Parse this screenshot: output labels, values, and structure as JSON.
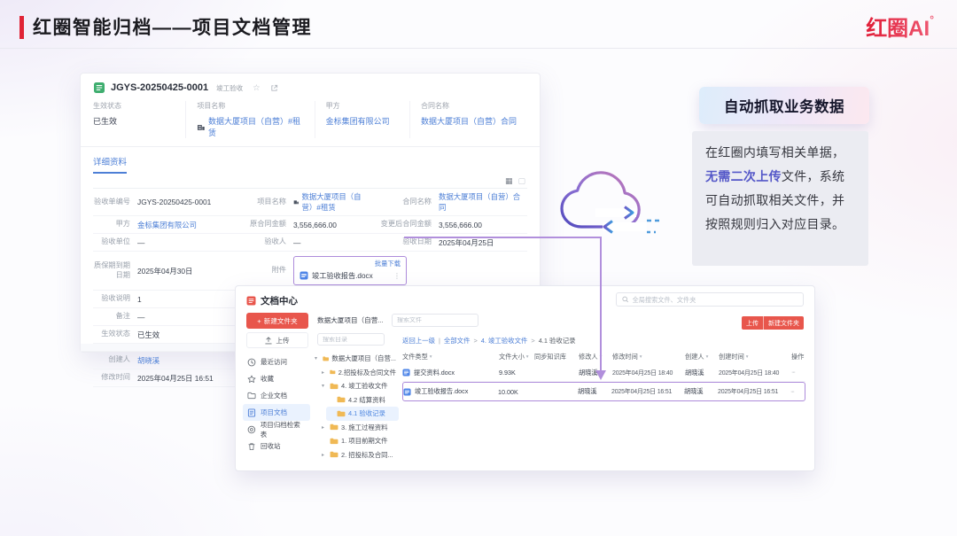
{
  "header": {
    "title": "红圈智能归档——项目文档管理",
    "logo_text": "红圈AI",
    "logo_sup": "°"
  },
  "icons": {
    "star": "☆",
    "share": "⧉",
    "grid": "▦",
    "panel": "▢",
    "more_v": "⋮",
    "more_h": "···",
    "caret": "▾",
    "open": "▾",
    "closed": "▸",
    "plus": "+",
    "sep_bar": "|",
    "sep_gt": ">"
  },
  "form": {
    "number": "JGYS-20250425-0001",
    "type_tag": "竣工验收",
    "summary": {
      "status_label": "生效状态",
      "status": "已生效",
      "project_label": "项目名称",
      "project": "数据大厦项目（自营）#租赁",
      "party_a_label": "甲方",
      "party_a": "金标集团有限公司",
      "contract_label": "合同名称",
      "contract": "数据大厦项目（自营）合同"
    },
    "tab": "详细资料",
    "detail": {
      "acceptance_no_label": "验收单编号",
      "acceptance_no": "JGYS-20250425-0001",
      "project_label": "项目名称",
      "project": "数据大厦项目（自营）#租赁",
      "contract_label": "合同名称",
      "contract": "数据大厦项目（自营）合同",
      "party_a_label": "甲方",
      "party_a": "金标集团有限公司",
      "orig_amount_label": "原合同金额",
      "orig_amount": "3,556,666.00",
      "changed_amount_label": "变更后合同金额",
      "changed_amount": "3,556,666.00",
      "accept_unit_label": "验收单位",
      "accept_unit": "—",
      "acceptor_label": "验收人",
      "acceptor": "—",
      "accept_date_label": "验收日期",
      "accept_date": "2025年04月25日",
      "warranty_label": "质保期到期日期",
      "warranty": "2025年04月30日",
      "attachment_label": "附件",
      "batch_download": "批量下载",
      "attachment_file": "竣工验收报告.docx",
      "accept_note_label": "验收说明",
      "accept_note": "1",
      "remark_label": "备注",
      "remark": "—",
      "status_label": "生效状态",
      "status": "已生效",
      "creator_label": "创建人",
      "creator": "胡晓溪",
      "modified_label": "修改时间",
      "modified_time": "2025年04月25日 16:51"
    }
  },
  "doc_center": {
    "title": "文档中心",
    "global_search_placeholder": "全局搜索文件、文件夹",
    "new_folder_button": "新建文件夹",
    "upload_button": "上传",
    "top_upload_button": "上传",
    "top_new_folder_button": "新建文件夹",
    "project_tab": "数据大厦项目（自营...",
    "search_file_placeholder": "搜索文件",
    "search_dir_placeholder": "搜索目录",
    "breadcrumb": {
      "back": "返回上一级",
      "items": [
        "全部文件",
        "4. 竣工验收文件",
        "4.1 验收记录"
      ]
    },
    "nav": [
      {
        "label": "最近访问"
      },
      {
        "label": "收藏"
      },
      {
        "label": "企业文档"
      },
      {
        "label": "项目文档"
      },
      {
        "label": "项目归档检索表"
      },
      {
        "label": "回收站"
      }
    ],
    "tree": [
      {
        "label": "数据大厦项目（自营..."
      },
      {
        "label": "2.招投标及合同文件"
      },
      {
        "label": "4. 竣工验收文件"
      },
      {
        "label": "4.2 结算资料"
      },
      {
        "label": "4.1 验收记录"
      },
      {
        "label": "3. 施工过程资料"
      },
      {
        "label": "1. 项目前期文件"
      },
      {
        "label": "2. 招投标及合同..."
      }
    ],
    "table": {
      "headers": [
        "文件类型",
        "文件大小",
        "同步知识库",
        "修改人",
        "修改时间",
        "创建人",
        "创建时间",
        "操作"
      ],
      "rows": [
        {
          "name": "提交资料.docx",
          "size": "9.93K",
          "modifier": "胡晓溪",
          "modified": "2025年04月25日 18:40",
          "creator": "胡晓溪",
          "created": "2025年04月25日 18:40"
        },
        {
          "name": "竣工验收报告.docx",
          "size": "10.00K",
          "modifier": "胡晓溪",
          "modified": "2025年04月25日 16:51",
          "creator": "胡晓溪",
          "created": "2025年04月25日 16:51"
        }
      ]
    }
  },
  "callout": {
    "title": "自动抓取业务数据",
    "body_p1": "在红圈内填写相关单据，",
    "body_highlight": "无需二次上传",
    "body_p2": "文件，系统可自动抓取相关文件，并按照规则归入对应目录。"
  },
  "colors": {
    "brand_red": "#e02436",
    "button_red": "#e8564c",
    "link_blue": "#4d7fd6",
    "highlight_purple": "#5457c8",
    "connector_purple": "#b18fdc",
    "folder_yellow": "#f0b955"
  }
}
